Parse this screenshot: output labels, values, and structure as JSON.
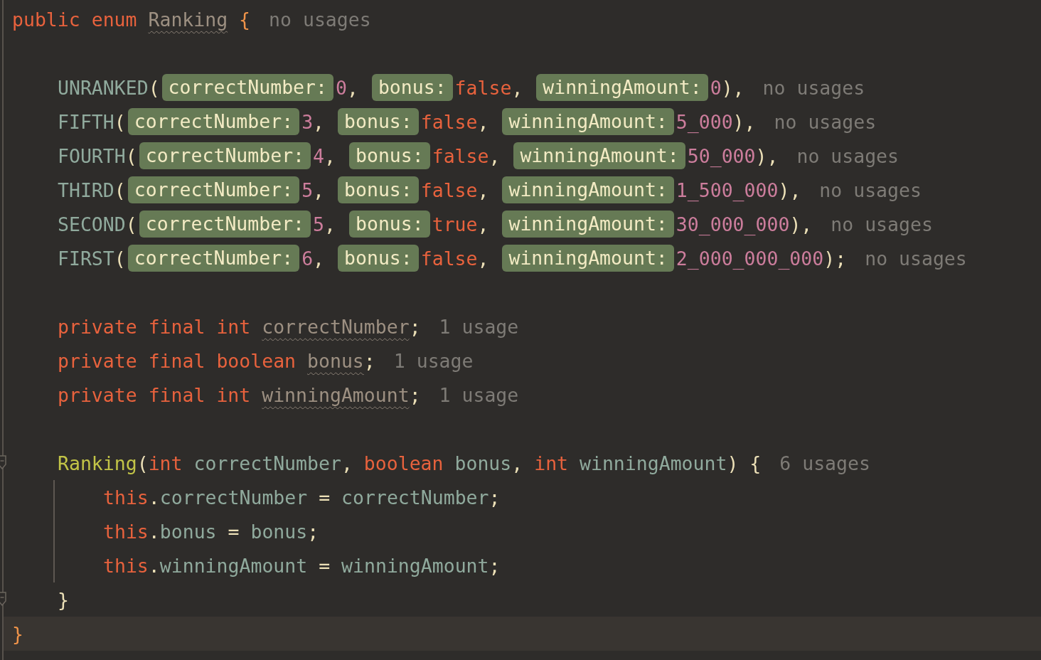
{
  "editor": {
    "lines": [
      {
        "kind": "code",
        "tokens": [
          {
            "kind": "kw",
            "text": "public "
          },
          {
            "kind": "kw",
            "text": "enum "
          },
          {
            "kind": "decl",
            "text": "Ranking",
            "underlined": true
          },
          {
            "kind": "brace",
            "text": " {"
          },
          {
            "kind": "usage",
            "text": "no usages"
          }
        ],
        "children": [
          {
            "kind": "blank"
          },
          {
            "kind": "code",
            "tokens": [
              {
                "kind": "const",
                "text": "UNRANKED"
              },
              {
                "kind": "punct",
                "text": "("
              },
              {
                "kind": "hint",
                "text": "correctNumber:"
              },
              {
                "kind": "num",
                "text": "0"
              },
              {
                "kind": "punct",
                "text": ", "
              },
              {
                "kind": "hint",
                "text": "bonus:"
              },
              {
                "kind": "kw",
                "text": "false"
              },
              {
                "kind": "punct",
                "text": ", "
              },
              {
                "kind": "hint",
                "text": "winningAmount:"
              },
              {
                "kind": "num",
                "text": "0"
              },
              {
                "kind": "punct",
                "text": "),"
              },
              {
                "kind": "usage",
                "text": "no usages"
              }
            ]
          },
          {
            "kind": "code",
            "tokens": [
              {
                "kind": "const",
                "text": "FIFTH"
              },
              {
                "kind": "punct",
                "text": "("
              },
              {
                "kind": "hint",
                "text": "correctNumber:"
              },
              {
                "kind": "num",
                "text": "3"
              },
              {
                "kind": "punct",
                "text": ", "
              },
              {
                "kind": "hint",
                "text": "bonus:"
              },
              {
                "kind": "kw",
                "text": "false"
              },
              {
                "kind": "punct",
                "text": ", "
              },
              {
                "kind": "hint",
                "text": "winningAmount:"
              },
              {
                "kind": "num",
                "text": "5_000"
              },
              {
                "kind": "punct",
                "text": "),"
              },
              {
                "kind": "usage",
                "text": "no usages"
              }
            ]
          },
          {
            "kind": "code",
            "tokens": [
              {
                "kind": "const",
                "text": "FOURTH"
              },
              {
                "kind": "punct",
                "text": "("
              },
              {
                "kind": "hint",
                "text": "correctNumber:"
              },
              {
                "kind": "num",
                "text": "4"
              },
              {
                "kind": "punct",
                "text": ", "
              },
              {
                "kind": "hint",
                "text": "bonus:"
              },
              {
                "kind": "kw",
                "text": "false"
              },
              {
                "kind": "punct",
                "text": ", "
              },
              {
                "kind": "hint",
                "text": "winningAmount:"
              },
              {
                "kind": "num",
                "text": "50_000"
              },
              {
                "kind": "punct",
                "text": "),"
              },
              {
                "kind": "usage",
                "text": "no usages"
              }
            ]
          },
          {
            "kind": "code",
            "tokens": [
              {
                "kind": "const",
                "text": "THIRD"
              },
              {
                "kind": "punct",
                "text": "("
              },
              {
                "kind": "hint",
                "text": "correctNumber:"
              },
              {
                "kind": "num",
                "text": "5"
              },
              {
                "kind": "punct",
                "text": ", "
              },
              {
                "kind": "hint",
                "text": "bonus:"
              },
              {
                "kind": "kw",
                "text": "false"
              },
              {
                "kind": "punct",
                "text": ", "
              },
              {
                "kind": "hint",
                "text": "winningAmount:"
              },
              {
                "kind": "num",
                "text": "1_500_000"
              },
              {
                "kind": "punct",
                "text": "),"
              },
              {
                "kind": "usage",
                "text": "no usages"
              }
            ]
          },
          {
            "kind": "code",
            "tokens": [
              {
                "kind": "const",
                "text": "SECOND"
              },
              {
                "kind": "punct",
                "text": "("
              },
              {
                "kind": "hint",
                "text": "correctNumber:"
              },
              {
                "kind": "num",
                "text": "5"
              },
              {
                "kind": "punct",
                "text": ", "
              },
              {
                "kind": "hint",
                "text": "bonus:"
              },
              {
                "kind": "kw",
                "text": "true"
              },
              {
                "kind": "punct",
                "text": ", "
              },
              {
                "kind": "hint",
                "text": "winningAmount:"
              },
              {
                "kind": "num",
                "text": "30_000_000"
              },
              {
                "kind": "punct",
                "text": "),"
              },
              {
                "kind": "usage",
                "text": "no usages"
              }
            ]
          },
          {
            "kind": "code",
            "tokens": [
              {
                "kind": "const",
                "text": "FIRST"
              },
              {
                "kind": "punct",
                "text": "("
              },
              {
                "kind": "hint",
                "text": "correctNumber:"
              },
              {
                "kind": "num",
                "text": "6"
              },
              {
                "kind": "punct",
                "text": ", "
              },
              {
                "kind": "hint",
                "text": "bonus:"
              },
              {
                "kind": "kw",
                "text": "false"
              },
              {
                "kind": "punct",
                "text": ", "
              },
              {
                "kind": "hint",
                "text": "winningAmount:"
              },
              {
                "kind": "num",
                "text": "2_000_000_000"
              },
              {
                "kind": "punct",
                "text": ");"
              },
              {
                "kind": "usage",
                "text": "no usages"
              }
            ]
          },
          {
            "kind": "blank"
          },
          {
            "kind": "code",
            "tokens": [
              {
                "kind": "kw",
                "text": "private "
              },
              {
                "kind": "kw",
                "text": "final "
              },
              {
                "kind": "kw",
                "text": "int "
              },
              {
                "kind": "decl",
                "text": "correctNumber",
                "underlined": true
              },
              {
                "kind": "punct",
                "text": ";"
              },
              {
                "kind": "usage",
                "text": "1 usage"
              }
            ]
          },
          {
            "kind": "code",
            "tokens": [
              {
                "kind": "kw",
                "text": "private "
              },
              {
                "kind": "kw",
                "text": "final "
              },
              {
                "kind": "kw",
                "text": "boolean "
              },
              {
                "kind": "decl",
                "text": "bonus",
                "underlined": true
              },
              {
                "kind": "punct",
                "text": ";"
              },
              {
                "kind": "usage",
                "text": "1 usage"
              }
            ]
          },
          {
            "kind": "code",
            "tokens": [
              {
                "kind": "kw",
                "text": "private "
              },
              {
                "kind": "kw",
                "text": "final "
              },
              {
                "kind": "kw",
                "text": "int "
              },
              {
                "kind": "decl",
                "text": "winningAmount",
                "underlined": true
              },
              {
                "kind": "punct",
                "text": ";"
              },
              {
                "kind": "usage",
                "text": "1 usage"
              }
            ]
          },
          {
            "kind": "blank"
          },
          {
            "kind": "code",
            "fold_marker": true,
            "tokens": [
              {
                "kind": "method",
                "text": "Ranking"
              },
              {
                "kind": "punct",
                "text": "("
              },
              {
                "kind": "kw",
                "text": "int "
              },
              {
                "kind": "var",
                "text": "correctNumber"
              },
              {
                "kind": "punct",
                "text": ", "
              },
              {
                "kind": "kw",
                "text": "boolean "
              },
              {
                "kind": "var",
                "text": "bonus"
              },
              {
                "kind": "punct",
                "text": ", "
              },
              {
                "kind": "kw",
                "text": "int "
              },
              {
                "kind": "var",
                "text": "winningAmount"
              },
              {
                "kind": "punct",
                "text": ") {"
              },
              {
                "kind": "usage",
                "text": "6 usages"
              }
            ],
            "children": [
              {
                "kind": "code",
                "tokens": [
                  {
                    "kind": "kw",
                    "text": "this"
                  },
                  {
                    "kind": "punct",
                    "text": "."
                  },
                  {
                    "kind": "var",
                    "text": "correctNumber"
                  },
                  {
                    "kind": "punct",
                    "text": " = "
                  },
                  {
                    "kind": "var",
                    "text": "correctNumber"
                  },
                  {
                    "kind": "punct",
                    "text": ";"
                  }
                ]
              },
              {
                "kind": "code",
                "tokens": [
                  {
                    "kind": "kw",
                    "text": "this"
                  },
                  {
                    "kind": "punct",
                    "text": "."
                  },
                  {
                    "kind": "var",
                    "text": "bonus"
                  },
                  {
                    "kind": "punct",
                    "text": " = "
                  },
                  {
                    "kind": "var",
                    "text": "bonus"
                  },
                  {
                    "kind": "punct",
                    "text": ";"
                  }
                ]
              },
              {
                "kind": "code",
                "tokens": [
                  {
                    "kind": "kw",
                    "text": "this"
                  },
                  {
                    "kind": "punct",
                    "text": "."
                  },
                  {
                    "kind": "var",
                    "text": "winningAmount"
                  },
                  {
                    "kind": "punct",
                    "text": " = "
                  },
                  {
                    "kind": "var",
                    "text": "winningAmount"
                  },
                  {
                    "kind": "punct",
                    "text": ";"
                  }
                ]
              }
            ]
          },
          {
            "kind": "code",
            "fold_marker": true,
            "tokens": [
              {
                "kind": "punct",
                "text": "}"
              }
            ]
          }
        ]
      },
      {
        "kind": "code",
        "current": true,
        "tokens": [
          {
            "kind": "brace",
            "text": "}"
          }
        ]
      }
    ]
  }
}
